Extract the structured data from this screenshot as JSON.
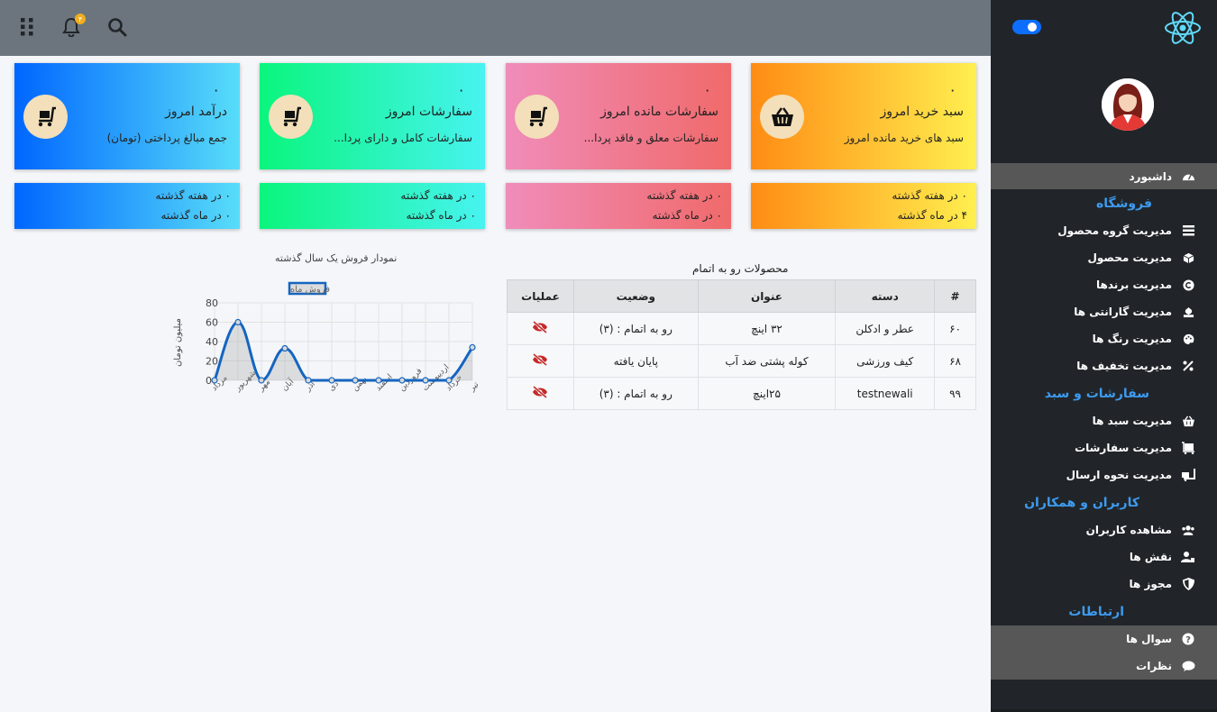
{
  "topbar": {
    "notification_count": "۴",
    "icons": [
      "grid-icon",
      "bell-icon",
      "search-icon"
    ]
  },
  "sidebar": {
    "logo": "react-logo",
    "items": [
      {
        "label": "داشبورد",
        "icon": "dashboard-icon",
        "type": "item",
        "active": true
      },
      {
        "label": "فروشگاه",
        "type": "heading"
      },
      {
        "label": "مدیریت گروه محصول",
        "icon": "layers-icon",
        "type": "item"
      },
      {
        "label": "مدیریت محصول",
        "icon": "box-icon",
        "type": "item"
      },
      {
        "label": "مدیریت برندها",
        "icon": "copyright-icon",
        "type": "item"
      },
      {
        "label": "مدیریت گارانتی ها",
        "icon": "hand-heart-icon",
        "type": "item"
      },
      {
        "label": "مدیریت رنگ ها",
        "icon": "palette-icon",
        "type": "item"
      },
      {
        "label": "مدیریت تخفیف ها",
        "icon": "percent-icon",
        "type": "item"
      },
      {
        "label": "سفارشات و سبد",
        "type": "heading"
      },
      {
        "label": "مدیریت سبد ها",
        "icon": "basket-icon",
        "type": "item"
      },
      {
        "label": "مدیریت سفارشات",
        "icon": "luggage-cart-icon",
        "type": "item"
      },
      {
        "label": "مدیریت نحوه ارسال",
        "icon": "truck-loading-icon",
        "type": "item"
      },
      {
        "label": "کاربران و همکاران",
        "type": "heading"
      },
      {
        "label": "مشاهده کاربران",
        "icon": "users-icon",
        "type": "item"
      },
      {
        "label": "نقش ها",
        "icon": "user-tag-icon",
        "type": "item"
      },
      {
        "label": "مجوز ها",
        "icon": "shield-icon",
        "type": "item"
      },
      {
        "label": "ارتباطات",
        "type": "heading"
      },
      {
        "label": "سوال ها",
        "icon": "question-icon",
        "type": "item"
      },
      {
        "label": "نظرات",
        "icon": "comment-icon",
        "type": "item"
      }
    ]
  },
  "cards": [
    {
      "value": "۰",
      "title": "سبد خرید امروز",
      "subtitle": "سبد های خرید مانده امروز",
      "icon": "basket-icon",
      "color": "#ffc93a",
      "week": "۰ در هفته گذشته",
      "month": "۴ در ماه گذشته"
    },
    {
      "value": "۰",
      "title": "سفارشات مانده امروز",
      "subtitle": "سفارشات معلق و فاقد پردا...",
      "icon": "cart-icon",
      "color": "#f07c98",
      "week": "۰ در هفته گذشته",
      "month": "۰ در ماه گذشته"
    },
    {
      "value": "۰",
      "title": "سفارشات امروز",
      "subtitle": "سفارشات کامل و دارای پردا...",
      "icon": "cart-icon",
      "color": "#2af2b5",
      "week": "۰ در هفته گذشته",
      "month": "۰ در ماه گذشته"
    },
    {
      "value": "۰",
      "title": "درآمد امروز",
      "subtitle": "جمع مبالغ پرداختی (تومان)",
      "icon": "cart-icon",
      "color": "#2a9cfb",
      "week": "۰ در هفته گذشته",
      "month": "۰ در ماه گذشته"
    }
  ],
  "products_table": {
    "title": "محصولات رو به اتمام",
    "headers": [
      "#",
      "دسته",
      "عنوان",
      "وضعیت",
      "عملیات"
    ],
    "rows": [
      {
        "id": "۶۰",
        "category": "عطر و ادکلن",
        "title": "۳۲ اینچ",
        "status": "رو به اتمام : (۳)",
        "status_color": "#222222",
        "action_icon": "eye-slash-icon"
      },
      {
        "id": "۶۸",
        "category": "کیف ورزشی",
        "title": "کوله پشتی ضد آب",
        "status": "پایان یافته",
        "status_color": "#d32f2f",
        "action_icon": "eye-slash-icon"
      },
      {
        "id": "۹۹",
        "category": "testnewali",
        "title": "۲۵اینچ",
        "status": "رو به اتمام : (۳)",
        "status_color": "#222222",
        "action_icon": "eye-slash-icon"
      }
    ]
  },
  "chart_data": {
    "type": "line",
    "title": "نمودار فروش یک سال گذشته",
    "ylabel": "میلیون تومان",
    "xlabel": "",
    "categories": [
      "مرداد",
      "شهریور",
      "مهر",
      "آبان",
      "آذر",
      "دی",
      "بهمن",
      "اسفند",
      "فروردین",
      "اردیبهشت",
      "خرداد",
      "تیر"
    ],
    "series": [
      {
        "name": "فروش ماه",
        "values": [
          0,
          60,
          0,
          33,
          0,
          0,
          0,
          0,
          0,
          0,
          0,
          34
        ],
        "color": "#1565c0"
      }
    ],
    "ylim": [
      0,
      80
    ],
    "yticks": [
      0,
      20,
      40,
      60,
      80
    ],
    "grid": true,
    "legend": "top"
  }
}
